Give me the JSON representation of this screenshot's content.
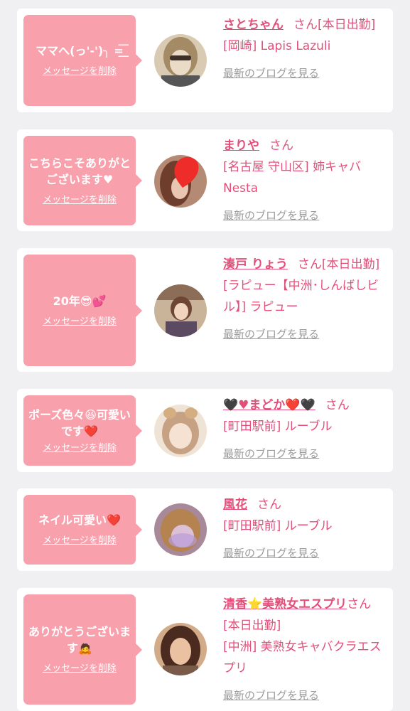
{
  "common": {
    "delete_label": "メッセージを削除",
    "blog_label": "最新のブログを見る",
    "san": "さん"
  },
  "cards": [
    {
      "message": "ママへ(っ'-')╮ =͟͟͞͞",
      "name": "さとちゃん",
      "status": "[本日出勤]",
      "shop": "[岡崎] Lapis Lazuli",
      "avatar_colors": [
        "#c9b9a0",
        "#5a4a3c"
      ]
    },
    {
      "message": "こちらこそありがとございます♥",
      "name": "まりや",
      "status": "",
      "shop": "[名古屋 守山区] 姉キャバ Nesta",
      "avatar_colors": [
        "#a06a55",
        "#e8322e"
      ]
    },
    {
      "message": "20年😎💕",
      "name": "湊戸 りょう",
      "status": "[本日出勤]",
      "shop": "[ラピュー【中洲･しんばしビル】] ラピュー",
      "avatar_colors": [
        "#b9a389",
        "#6b4c3b"
      ]
    },
    {
      "message": "ポーズ色々😆可愛いです❤️",
      "name": "🖤♥まどか❤️🖤",
      "status": "",
      "shop": "[町田駅前] ルーブル",
      "avatar_colors": [
        "#ecd8c4",
        "#b89777"
      ]
    },
    {
      "message": "ネイル可愛い❤️",
      "name": "風花",
      "status": "",
      "shop": "[町田駅前] ルーブル",
      "avatar_colors": [
        "#c7a6b0",
        "#6e4b5e"
      ]
    },
    {
      "message": "ありがとうございます🙇",
      "name": "清香⭐️美熟女エスプリ",
      "status": "[本日出勤]",
      "shop": "[中洲] 美熟女キャバクラエスプリ",
      "avatar_colors": [
        "#d5a37c",
        "#4b2d22"
      ]
    }
  ]
}
